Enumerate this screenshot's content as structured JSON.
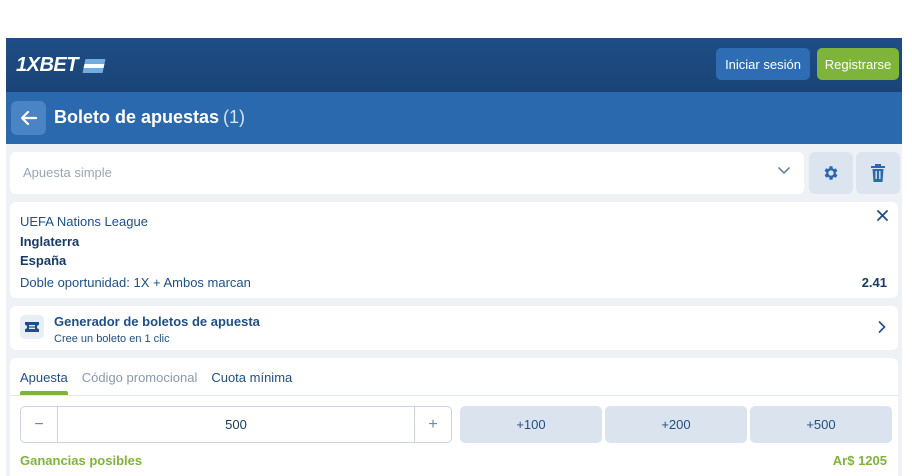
{
  "brand": {
    "logo_text": "1XBET",
    "flag_colors": [
      "#74acdf",
      "#ffffff",
      "#74acdf"
    ]
  },
  "header": {
    "login_label": "Iniciar sesión",
    "register_label": "Registrarse"
  },
  "betslip": {
    "title": "Boleto de apuestas",
    "count": "(1)"
  },
  "bet_type": {
    "selected": "Apuesta simple"
  },
  "selection": {
    "league": "UEFA Nations League",
    "team1": "Inglaterra",
    "team2": "España",
    "market": "Doble oportunidad: 1X + Ambos marcan",
    "odds": "2.41"
  },
  "generator": {
    "title": "Generador de boletos de apuesta",
    "subtitle": "Cree un boleto en 1 clic"
  },
  "stake": {
    "tabs": [
      "Apuesta",
      "Código promocional",
      "Cuota mínima"
    ],
    "active_tab": "Apuesta",
    "minus": "−",
    "plus": "+",
    "value": "500",
    "quick": [
      "+100",
      "+200",
      "+500"
    ],
    "gain_label": "Ganancias posibles",
    "gain_value": "Ar$ 1205"
  },
  "colors": {
    "topbar": "#1e4d85",
    "subheader": "#2a69ad",
    "accent_green": "#7fb43a",
    "text_blue": "#1f4f86"
  },
  "icons": [
    "back-arrow-icon",
    "chevron-down-icon",
    "gear-icon",
    "trash-icon",
    "close-icon",
    "ticket-icon",
    "chevron-right-icon"
  ]
}
